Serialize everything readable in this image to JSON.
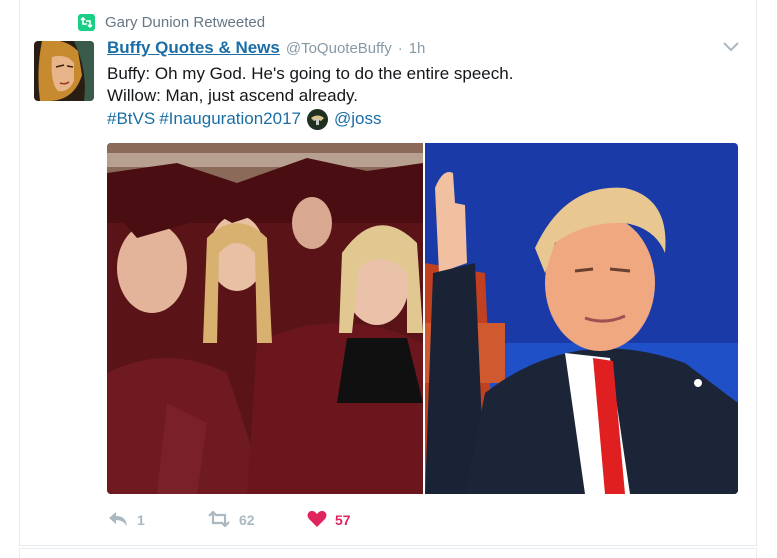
{
  "retweet_context": {
    "text": "Gary Dunion Retweeted"
  },
  "tweet": {
    "display_name": "Buffy Quotes & News",
    "handle": "@ToQuoteBuffy",
    "separator": "·",
    "time": "1h",
    "lines": [
      "Buffy: Oh my God. He's going to do the entire speech.",
      "Willow: Man, just ascend already."
    ],
    "hashtags": [
      "#BtVS",
      "#Inauguration2017"
    ],
    "mention": "@joss"
  },
  "actions": {
    "reply_count": "1",
    "retweet_count": "62",
    "like_count": "57"
  },
  "colors": {
    "link": "#1b6ea5",
    "retweet_green": "#19cf86",
    "like_red": "#e0245e",
    "muted": "#657786"
  },
  "icons": [
    "retweet-icon",
    "chevron-down-icon",
    "reply-icon",
    "retweet-action-icon",
    "heart-icon",
    "eagle-seal-emoji"
  ]
}
